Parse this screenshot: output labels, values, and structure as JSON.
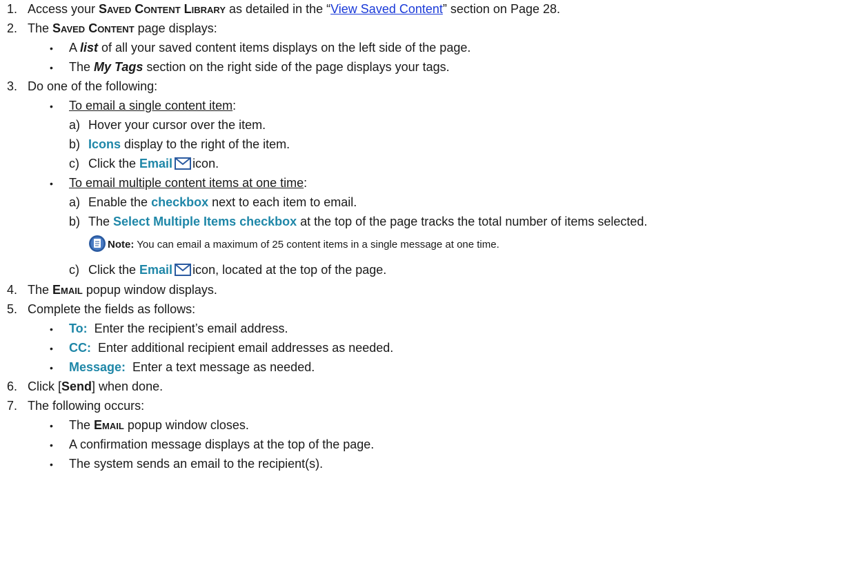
{
  "steps": {
    "s1": {
      "num": "1.",
      "pre": "Access your ",
      "strong": "Saved Content Library",
      "mid": " as detailed in the “",
      "link": "View Saved Content",
      "post": "” section on Page 28."
    },
    "s2": {
      "num": "2.",
      "pre": "The ",
      "strong": "Saved Content",
      "post": " page displays:",
      "b1": {
        "pre": "A ",
        "em": "list",
        "post": " of all your saved content items displays on the left side of the page."
      },
      "b2": {
        "pre": "The ",
        "em": "My Tags",
        "post": " section on the right side of the page displays your tags."
      }
    },
    "s3": {
      "num": "3.",
      "text": "Do one of the following:",
      "single": {
        "heading": "To email a single content item",
        "colon": ":",
        "a": {
          "num": "a)",
          "text": "Hover your cursor over the item."
        },
        "b": {
          "num": "b)",
          "accent": "Icons",
          "post": " display to the right of the item."
        },
        "c": {
          "num": "c)",
          "pre": "Click the ",
          "accent": "Email",
          "post": "icon."
        }
      },
      "multi": {
        "heading": "To email multiple content items at one time",
        "colon": ":",
        "a": {
          "num": "a)",
          "pre": "Enable the ",
          "accent": "checkbox",
          "post": " next to each item to email."
        },
        "b": {
          "num": "b)",
          "pre": "The ",
          "accent": "Select Multiple Items checkbox",
          "post": " at the top of the page tracks the total number of items selected."
        },
        "note": {
          "label": "Note:",
          "text": " You can email a maximum of 25 content items in a single message at one time."
        },
        "c": {
          "num": "c)",
          "pre": "Click the ",
          "accent": "Email",
          "post": "icon, located at the top of the page."
        }
      }
    },
    "s4": {
      "num": "4.",
      "pre": "The ",
      "strong": "Email",
      "post": " popup window displays."
    },
    "s5": {
      "num": "5.",
      "text": "Complete the fields as follows:",
      "f1": {
        "label": "To:",
        "text": "  Enter the recipient’s email address."
      },
      "f2": {
        "label": "CC:",
        "text": "  Enter additional recipient email addresses as needed."
      },
      "f3": {
        "label": "Message:",
        "text": "  Enter a text message as needed."
      }
    },
    "s6": {
      "num": "6.",
      "pre": "Click [",
      "strong": "Send",
      "post": "] when done."
    },
    "s7": {
      "num": "7.",
      "text": "The following occurs:",
      "o1": {
        "pre": "The ",
        "strong": "Email",
        "post": " popup window closes."
      },
      "o2": {
        "text": "A confirmation message displays at the top of the page."
      },
      "o3": {
        "text": "The system sends an email to the recipient(s)."
      }
    }
  },
  "bullet": "•",
  "icons": {
    "email": "envelope-icon",
    "note": "note-icon"
  },
  "colors": {
    "accent": "#1f87a8",
    "link": "#1a3ad8",
    "icon": "#2a5aa0"
  }
}
